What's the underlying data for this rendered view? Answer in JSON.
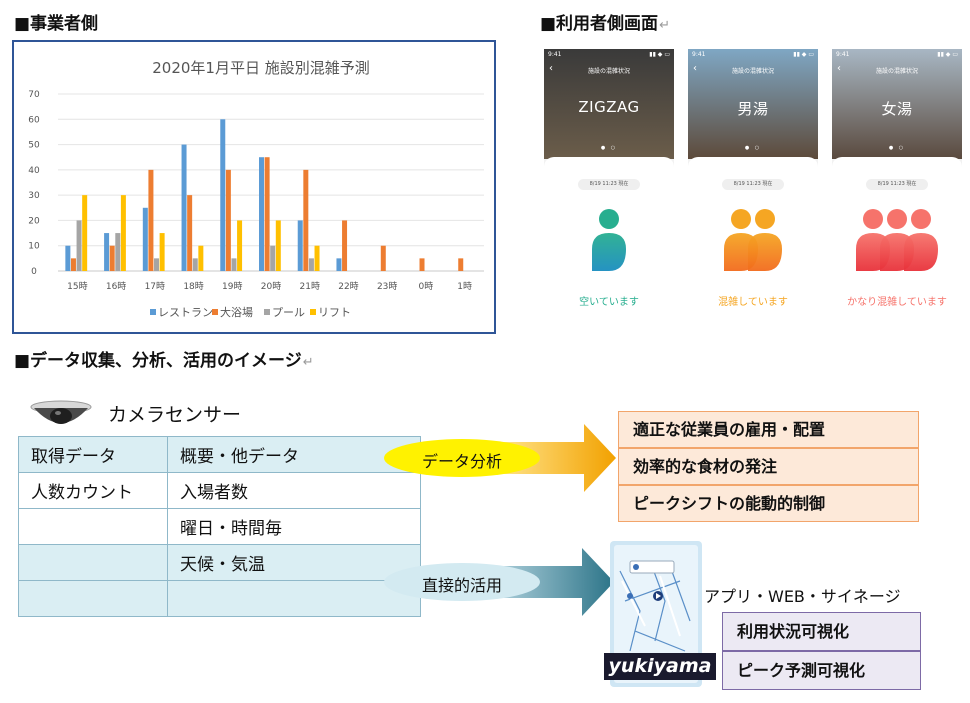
{
  "headings": {
    "operator_side": "■事業者側",
    "user_screen": "■利用者側画面",
    "data_flow": "■データ収集、分析、活用のイメージ",
    "return_mark": "↵"
  },
  "chart_data": {
    "type": "bar",
    "title": "2020年1月平日  施設別混雑予測",
    "categories": [
      "15時",
      "16時",
      "17時",
      "18時",
      "19時",
      "20時",
      "21時",
      "22時",
      "23時",
      "0時",
      "1時"
    ],
    "ylim": [
      0,
      70
    ],
    "yticks": [
      "0",
      "10",
      "20",
      "30",
      "40",
      "50",
      "60",
      "70"
    ],
    "grid": true,
    "legend_position": "bottom",
    "series": [
      {
        "name": "レストラン",
        "color": "#5b9bd5",
        "values": [
          10,
          15,
          25,
          50,
          60,
          45,
          20,
          5,
          null,
          null,
          null
        ]
      },
      {
        "name": "大浴場",
        "color": "#ed7d31",
        "values": [
          5,
          10,
          40,
          30,
          40,
          45,
          40,
          20,
          10,
          5,
          5
        ]
      },
      {
        "name": "プール",
        "color": "#a5a5a5",
        "values": [
          20,
          15,
          5,
          5,
          5,
          10,
          5,
          null,
          null,
          null,
          null
        ]
      },
      {
        "name": "リフト",
        "color": "#ffc000",
        "values": [
          30,
          30,
          15,
          10,
          20,
          20,
          10,
          null,
          null,
          null,
          null
        ]
      }
    ]
  },
  "phones": [
    {
      "status_time": "9:41",
      "screen_title": "施設の混雑状況",
      "venue": "ZIGZAG",
      "date": "8/19 11:23 現在",
      "message": "空いています",
      "level": 1,
      "color": "#27ae8f",
      "color2": "#1a8dbf",
      "icon": "person-icon"
    },
    {
      "status_time": "9:41",
      "screen_title": "施設の混雑状況",
      "venue": "男湯",
      "date": "8/19 11:23 現在",
      "message": "混雑しています",
      "level": 2,
      "color": "#f5a623",
      "color2": "#f26b1d",
      "icon": "two-people-icon"
    },
    {
      "status_time": "9:41",
      "screen_title": "施設の混雑状況",
      "venue": "女湯",
      "date": "8/19 11:23 現在",
      "message": "かなり混雑しています",
      "level": 3,
      "color": "#f6736b",
      "color2": "#e8313a",
      "icon": "three-people-icon"
    }
  ],
  "camera": {
    "label": "カメラセンサー",
    "icon": "camera-icon"
  },
  "table": {
    "rows": [
      [
        "取得データ",
        "概要・他データ"
      ],
      [
        "人数カウント",
        "入場者数"
      ],
      [
        "",
        "曜日・時間毎"
      ],
      [
        "",
        "天候・気温"
      ],
      [
        "",
        ""
      ]
    ]
  },
  "flows": {
    "analysis_label": "データ分析",
    "direct_label": "直接的活用"
  },
  "analysis_results": [
    "適正な従業員の雇用・配置",
    "効率的な食材の発注",
    "ピークシフトの能動的制御"
  ],
  "direct_results": {
    "channels": "アプリ・WEB・サイネージ",
    "items": [
      "利用状況可視化",
      "ピーク予測可視化"
    ],
    "app_logo": "yukiyama"
  }
}
